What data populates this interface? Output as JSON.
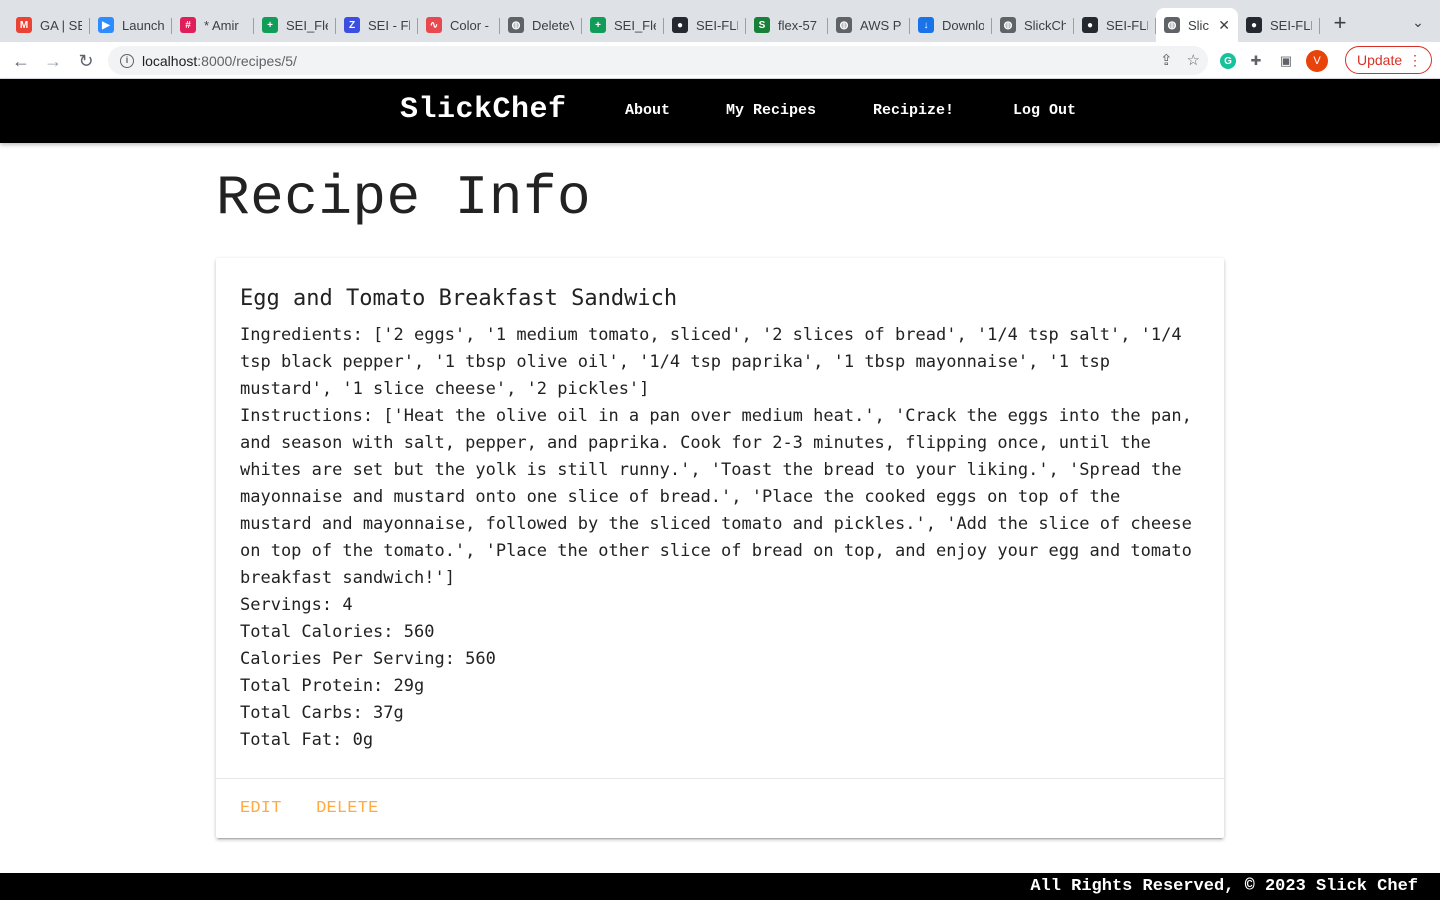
{
  "browser": {
    "tabs": [
      {
        "label": "GA | SE",
        "icon": "gmail-icon",
        "color": "#ea4335",
        "glyph": "M"
      },
      {
        "label": "Launch",
        "icon": "zoom-icon",
        "color": "#2d8cff",
        "glyph": "▶"
      },
      {
        "label": "* Amir",
        "icon": "slack-icon",
        "color": "#e01e5a",
        "glyph": "#"
      },
      {
        "label": "SEI_Fle",
        "icon": "sheets-icon",
        "color": "#0f9d58",
        "glyph": "+"
      },
      {
        "label": "SEI - Fl",
        "icon": "zapier-icon",
        "color": "#3b4ee0",
        "glyph": "Z"
      },
      {
        "label": "Color -",
        "icon": "color-icon",
        "color": "#e8484e",
        "glyph": "∿"
      },
      {
        "label": "DeleteV",
        "icon": "globe-icon",
        "color": "#5f6368",
        "glyph": "◍"
      },
      {
        "label": "SEI_Fle",
        "icon": "sheets-icon",
        "color": "#0f9d58",
        "glyph": "+"
      },
      {
        "label": "SEI-FLE",
        "icon": "github-icon",
        "color": "#24292f",
        "glyph": "●"
      },
      {
        "label": "flex-57",
        "icon": "sheets-icon",
        "color": "#188038",
        "glyph": "S"
      },
      {
        "label": "AWS Po",
        "icon": "globe-icon",
        "color": "#5f6368",
        "glyph": "◍"
      },
      {
        "label": "Downlo",
        "icon": "download-icon",
        "color": "#1a73e8",
        "glyph": "↓"
      },
      {
        "label": "SlickCh",
        "icon": "globe-icon",
        "color": "#5f6368",
        "glyph": "◍"
      },
      {
        "label": "SEI-FLE",
        "icon": "github-icon",
        "color": "#24292f",
        "glyph": "●"
      },
      {
        "label": "Slic",
        "icon": "globe-icon",
        "color": "#5f6368",
        "glyph": "◍",
        "active": true
      },
      {
        "label": "SEI-FLE",
        "icon": "github-icon",
        "color": "#24292f",
        "glyph": "●"
      }
    ],
    "url_host": "localhost",
    "url_path": ":8000/recipes/5/",
    "update_label": "Update",
    "avatar_letter": "V"
  },
  "site": {
    "brand": "SlickChef",
    "nav": [
      "About",
      "My Recipes",
      "Recipize!",
      "Log Out"
    ],
    "footer": "All Rights Reserved, © 2023 Slick Chef"
  },
  "page": {
    "title": "Recipe Info",
    "recipe": {
      "name": "Egg and Tomato Breakfast Sandwich",
      "ingredients": "Ingredients: ['2 eggs', '1 medium tomato, sliced', '2 slices of bread', '1/4 tsp salt', '1/4 tsp black pepper', '1 tbsp olive oil', '1/4 tsp paprika', '1 tbsp mayonnaise', '1 tsp mustard', '1 slice cheese', '2 pickles']",
      "instructions": "Instructions: ['Heat the olive oil in a pan over medium heat.', 'Crack the eggs into the pan, and season with salt, pepper, and paprika. Cook for 2-3 minutes, flipping once, until the whites are set but the yolk is still runny.', 'Toast the bread to your liking.', 'Spread the mayonnaise and mustard onto one slice of bread.', 'Place the cooked eggs on top of the mustard and mayonnaise, followed by the sliced tomato and pickles.', 'Add the slice of cheese on top of the tomato.', 'Place the other slice of bread on top, and enjoy your egg and tomato breakfast sandwich!']",
      "servings": "Servings: 4",
      "total_calories": "Total Calories: 560",
      "calories_per_serving": "Calories Per Serving: 560",
      "total_protein": "Total Protein: 29g",
      "total_carbs": "Total Carbs: 37g",
      "total_fat": "Total Fat: 0g"
    },
    "actions": {
      "edit": "Edit",
      "delete": "Delete"
    }
  },
  "colors": {
    "nav_bg": "#000000",
    "accent": "#ffab40"
  }
}
